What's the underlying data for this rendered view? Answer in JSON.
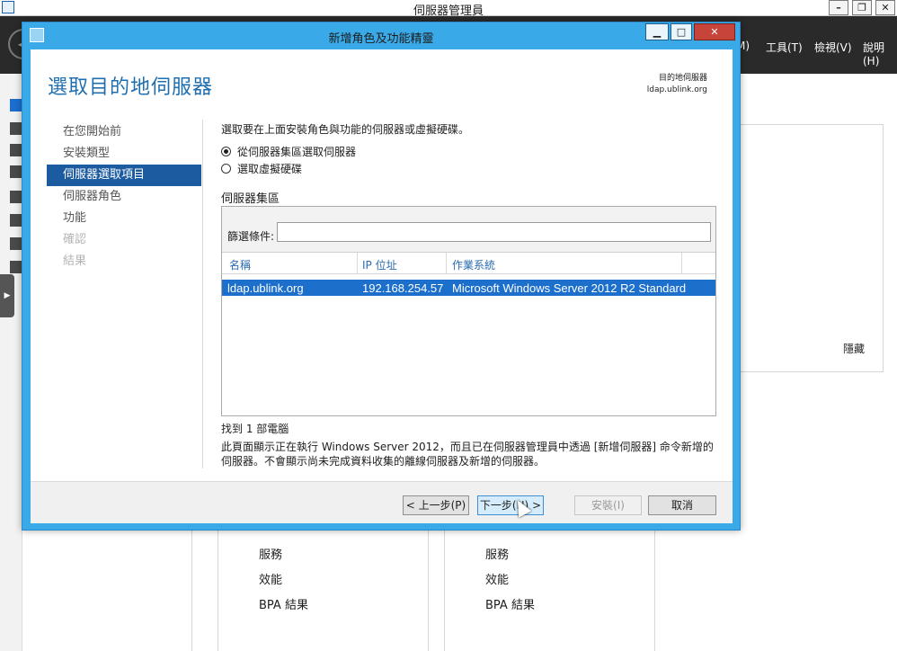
{
  "background": {
    "window_title": "伺服器管理員",
    "menu": {
      "manage_tail": "M)",
      "tools": "工具(T)",
      "view": "檢視(V)",
      "help": "說明(H)"
    },
    "hide_label": "隱藏",
    "tile_left": [
      "服務",
      "效能",
      "BPA 結果"
    ],
    "tile_right": [
      "服務",
      "效能",
      "BPA 結果"
    ]
  },
  "dialog": {
    "title": "新增角色及功能精靈",
    "heading": "選取目的地伺服器",
    "destination_label": "目的地伺服器",
    "destination_server": "ldap.ublink.org",
    "nav": [
      {
        "label": "在您開始前",
        "state": "normal"
      },
      {
        "label": "安裝類型",
        "state": "normal"
      },
      {
        "label": "伺服器選取項目",
        "state": "active"
      },
      {
        "label": "伺服器角色",
        "state": "normal"
      },
      {
        "label": "功能",
        "state": "normal"
      },
      {
        "label": "確認",
        "state": "disabled"
      },
      {
        "label": "結果",
        "state": "disabled"
      }
    ],
    "instruction": "選取要在上面安裝角色與功能的伺服器或虛擬硬碟。",
    "options": [
      {
        "label": "從伺服器集區選取伺服器",
        "checked": true
      },
      {
        "label": "選取虛擬硬碟",
        "checked": false
      }
    ],
    "pool_label": "伺服器集區",
    "filter_label": "篩選條件:",
    "filter_value": "",
    "columns": [
      "名稱",
      "IP 位址",
      "作業系統"
    ],
    "rows": [
      {
        "name": "ldap.ublink.org",
        "ip": "192.168.254.57",
        "os": "Microsoft Windows Server 2012 R2 Standard"
      }
    ],
    "found_text": "找到 1 部電腦",
    "description": "此頁面顯示正在執行 Windows Server 2012，而且已在伺服器管理員中透過 [新增伺服器] 命令新增的伺服器。不會顯示尚未完成資料收集的離線伺服器及新增的伺服器。",
    "buttons": {
      "previous": "< 上一步(P)",
      "next": "下一步(N) >",
      "install": "安裝(I)",
      "cancel": "取消"
    }
  }
}
